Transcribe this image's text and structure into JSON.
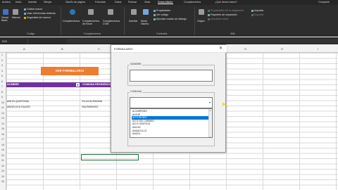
{
  "ribbon_tabs": [
    "Archivo",
    "Inicio",
    "Insertar",
    "Dibujar",
    "Diseño de página",
    "Fórmulas",
    "Datos",
    "Revisar",
    "Vista",
    "Desarrollador",
    "Complementos",
    "¿Qué desea hacer?",
    "Compartir"
  ],
  "groups": {
    "codigo": {
      "label": "Código",
      "visual_basic": "Visual Basic",
      "macros": "Macros",
      "grabar_macro": "Grabar macro",
      "referencias_relativas": "Usar referencias relativas",
      "seguridad_macros": "Seguridad de macros"
    },
    "complementos": {
      "label": "Complementos",
      "complementos": "Complementos",
      "complementos_excel": "Complementos de Excel",
      "complementos_com": "Complementos COM"
    },
    "controles": {
      "label": "Controles",
      "insertar": "Insertar",
      "modo_diseno": "Modo Diseño",
      "propiedades": "Propiedades",
      "ver_codigo": "Ver código",
      "ejecutar_dialogo": "Ejecutar cuadro de diálogo"
    },
    "xml": {
      "label": "XML",
      "origen": "Origen",
      "propiedades_asignacion": "Propiedades de la asignación",
      "paquetes_expansion": "Paquetes de expansión",
      "actualizar_datos": "Actualizar datos",
      "importar": "Importar",
      "exportar": "Exportar"
    }
  },
  "formula_bar": {
    "name_box": "B30"
  },
  "columns": [
    "A",
    "B",
    "C",
    "D",
    "E",
    "F",
    "G",
    "H",
    "I"
  ],
  "rows": [
    "1",
    "2",
    "3",
    "4",
    "5",
    "6",
    "7",
    "8",
    "9",
    "10",
    "11",
    "12",
    "13",
    "14",
    "15",
    "16",
    "17",
    "18",
    "19",
    "20",
    "21",
    "22",
    "23",
    "24",
    "25"
  ],
  "sheet": {
    "button_label": "VER FORMULARIO",
    "header_nombre": "NOMBRE",
    "header_comuna": "COMUNA RESIDENCIA",
    "rows": [
      {
        "nombre": "ANITA QUINTANA",
        "comuna": "VILLA ALEMANA"
      },
      {
        "nombre": "ANGELICA SUAZO",
        "comuna": "VALPARAISO"
      }
    ]
  },
  "dialog": {
    "title": "FORMULARIO",
    "nombre_label": "NOMBRE",
    "comuna_label": "COMUNA",
    "list_items": [
      "ALGARROBO",
      "ALHUÉ",
      "ALTO BIOBÍO",
      "ALTO DEL CARMEN",
      "ALTO HOSPICIO",
      "ANCUD",
      "ANDACOLLO",
      "ANGOL"
    ],
    "selected_index": 2
  },
  "colors": {
    "accent_orange": "#ed7d31",
    "header_purple": "#7030a0",
    "selection_blue": "#0078d7"
  }
}
